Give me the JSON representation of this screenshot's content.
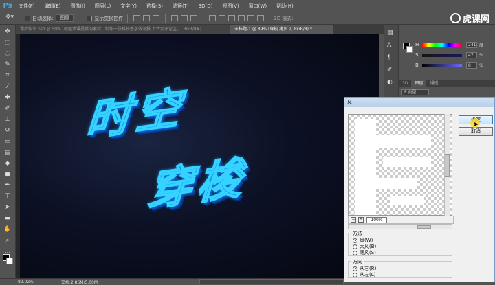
{
  "app": {
    "logo": "Ps"
  },
  "menu": [
    "文件(F)",
    "编辑(E)",
    "图像(I)",
    "图层(L)",
    "文字(Y)",
    "选择(S)",
    "滤镜(T)",
    "3D(D)",
    "视图(V)",
    "窗口(W)",
    "帮助(H)"
  ],
  "options": {
    "auto_select_label": "自动选择:",
    "auto_select_value": "图层",
    "show_transform_label": "显示变换控件",
    "mode_3d": "3D 模式:"
  },
  "brand": {
    "text": "虎课网"
  },
  "tabs": [
    {
      "label": "课后作业.psd @ 50% (根据本课提供的素材，制作一张科技感字效海报 上传到评论区。, RGB/8#)"
    },
    {
      "label": "未标题-1 @ 89% (穿梭 拷贝 2, RGB/8) *"
    }
  ],
  "status": {
    "zoom": "89.02%",
    "doc": "文档:2.86M/5.00M"
  },
  "canvas": {
    "line1": "时空",
    "line2": "穿梭"
  },
  "color_panel": {
    "rows": [
      {
        "label": "H",
        "value": "241",
        "unit": "度",
        "color": "#ff0000"
      },
      {
        "label": "S",
        "value": "47",
        "unit": "%",
        "color": "#7a7aff"
      },
      {
        "label": "B",
        "value": "8",
        "unit": "%",
        "color": "#555555"
      }
    ]
  },
  "layers_panel": {
    "tabs": [
      "3D",
      "图层",
      "通道"
    ],
    "filter": "P 类型"
  },
  "wind_dialog": {
    "title": "风",
    "ok": "确定",
    "cancel": "取消",
    "zoom": "100%",
    "method_label": "方法",
    "methods": [
      "风(W)",
      "大风(B)",
      "飓风(S)"
    ],
    "direction_label": "方向",
    "directions": [
      "从右(R)",
      "从左(L)"
    ]
  }
}
